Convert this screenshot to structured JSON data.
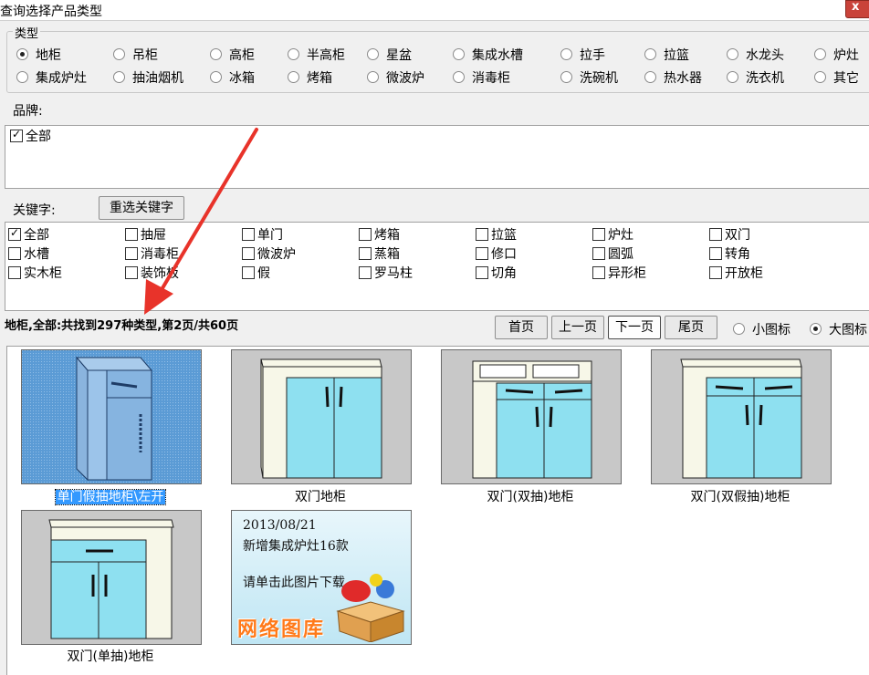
{
  "window": {
    "title": "查询选择产品类型",
    "close_label": "x"
  },
  "type_group": {
    "label": "类型",
    "selected": "地柜",
    "options": [
      "地柜",
      "吊柜",
      "高柜",
      "半高柜",
      "星盆",
      "集成水槽",
      "拉手",
      "拉篮",
      "水龙头",
      "炉灶",
      "集成炉灶",
      "抽油烟机",
      "冰箱",
      "烤箱",
      "微波炉",
      "消毒柜",
      "洗碗机",
      "热水器",
      "洗衣机",
      "其它"
    ]
  },
  "brand": {
    "label": "品牌:",
    "items": [
      {
        "label": "全部",
        "checked": true
      }
    ]
  },
  "keywords": {
    "label": "关键字:",
    "reset_button": "重选关键字",
    "items": [
      {
        "label": "全部",
        "checked": true
      },
      {
        "label": "抽屉",
        "checked": false
      },
      {
        "label": "单门",
        "checked": false
      },
      {
        "label": "烤箱",
        "checked": false
      },
      {
        "label": "拉篮",
        "checked": false
      },
      {
        "label": "炉灶",
        "checked": false
      },
      {
        "label": "双门",
        "checked": false
      },
      {
        "label": "水槽",
        "checked": false
      },
      {
        "label": "消毒柜",
        "checked": false
      },
      {
        "label": "微波炉",
        "checked": false
      },
      {
        "label": "蒸箱",
        "checked": false
      },
      {
        "label": "修口",
        "checked": false
      },
      {
        "label": "圆弧",
        "checked": false
      },
      {
        "label": "转角",
        "checked": false
      },
      {
        "label": "实木柜",
        "checked": false
      },
      {
        "label": "装饰板",
        "checked": false
      },
      {
        "label": "假",
        "checked": false
      },
      {
        "label": "罗马柱",
        "checked": false
      },
      {
        "label": "切角",
        "checked": false
      },
      {
        "label": "异形柜",
        "checked": false
      },
      {
        "label": "开放柜",
        "checked": false
      }
    ]
  },
  "status_text": "地柜,全部:共找到297种类型,第2页/共60页",
  "pager": {
    "first": "首页",
    "prev": "上一页",
    "next": "下一页",
    "last": "尾页"
  },
  "view_mode": {
    "small": "小图标",
    "large": "大图标",
    "selected": "large"
  },
  "results": [
    {
      "caption": "单门假抽地柜\\左开",
      "selected": true
    },
    {
      "caption": "双门地柜",
      "selected": false
    },
    {
      "caption": "双门(双抽)地柜",
      "selected": false
    },
    {
      "caption": "双门(双假抽)地柜",
      "selected": false
    },
    {
      "caption": "双门(单抽)地柜",
      "selected": false
    }
  ],
  "promo": {
    "date": "2013/08/21",
    "line1": "新增集成炉灶16款",
    "line2": "请单击此图片下载",
    "brand": "网络图库"
  },
  "colors": {
    "cabinet_door": "#8ee0f0",
    "cabinet_body": "#f5f5e6",
    "selection": "#3399ff",
    "arrow": "#e8332a"
  }
}
